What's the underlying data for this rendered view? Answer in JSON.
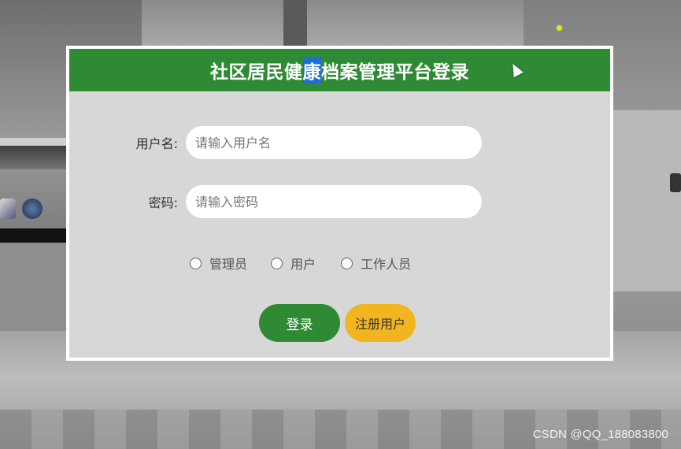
{
  "dialog": {
    "title_prefix": "社区居民健",
    "title_selected": "康",
    "title_suffix": "档案管理平台登录",
    "username_label": "用户名:",
    "username_placeholder": "请输入用户名",
    "username_value": "",
    "password_label": "密码:",
    "password_placeholder": "请输入密码",
    "password_value": "",
    "roles": [
      {
        "label": "管理员",
        "checked": false
      },
      {
        "label": "用户",
        "checked": false
      },
      {
        "label": "工作人员",
        "checked": false
      }
    ],
    "login_label": "登录",
    "register_label": "注册用户"
  },
  "watermark": "CSDN @QQ_188083800",
  "colors": {
    "header_green": "#2e8b34",
    "login_green": "#2e8b34",
    "register_yellow": "#f3b51f",
    "dialog_bg": "#d7d7d7",
    "selection_blue": "#1d6fd6"
  }
}
